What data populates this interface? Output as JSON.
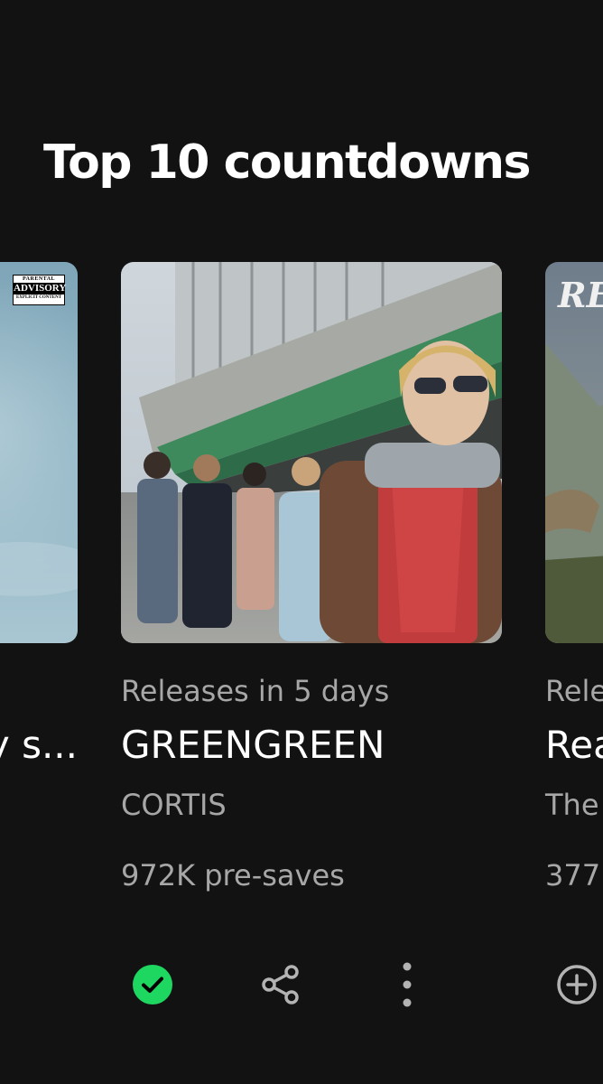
{
  "section": {
    "title": "Top 10 countdowns"
  },
  "cards": {
    "prev": {
      "title": "y s...",
      "advisory": {
        "top": "PARENTAL",
        "mid": "ADVISORY",
        "bottom": "EXPLICIT CONTENT"
      }
    },
    "main": {
      "release": "Releases in 5 days",
      "title": "GREENGREEN",
      "artist": "CORTIS",
      "presaves": "972K pre-saves",
      "saved": true
    },
    "next": {
      "cover_text": "RE",
      "release": "Rele",
      "title": "Rea",
      "artist": "The",
      "presaves": "377."
    }
  },
  "colors": {
    "background": "#121212",
    "accent": "#1ed760",
    "muted_text": "#a7a7a7",
    "icon": "#b3b3b3"
  },
  "icons": {
    "check": "check-circle-icon",
    "share": "share-icon",
    "more": "more-vertical-icon",
    "add": "plus-circle-icon"
  }
}
